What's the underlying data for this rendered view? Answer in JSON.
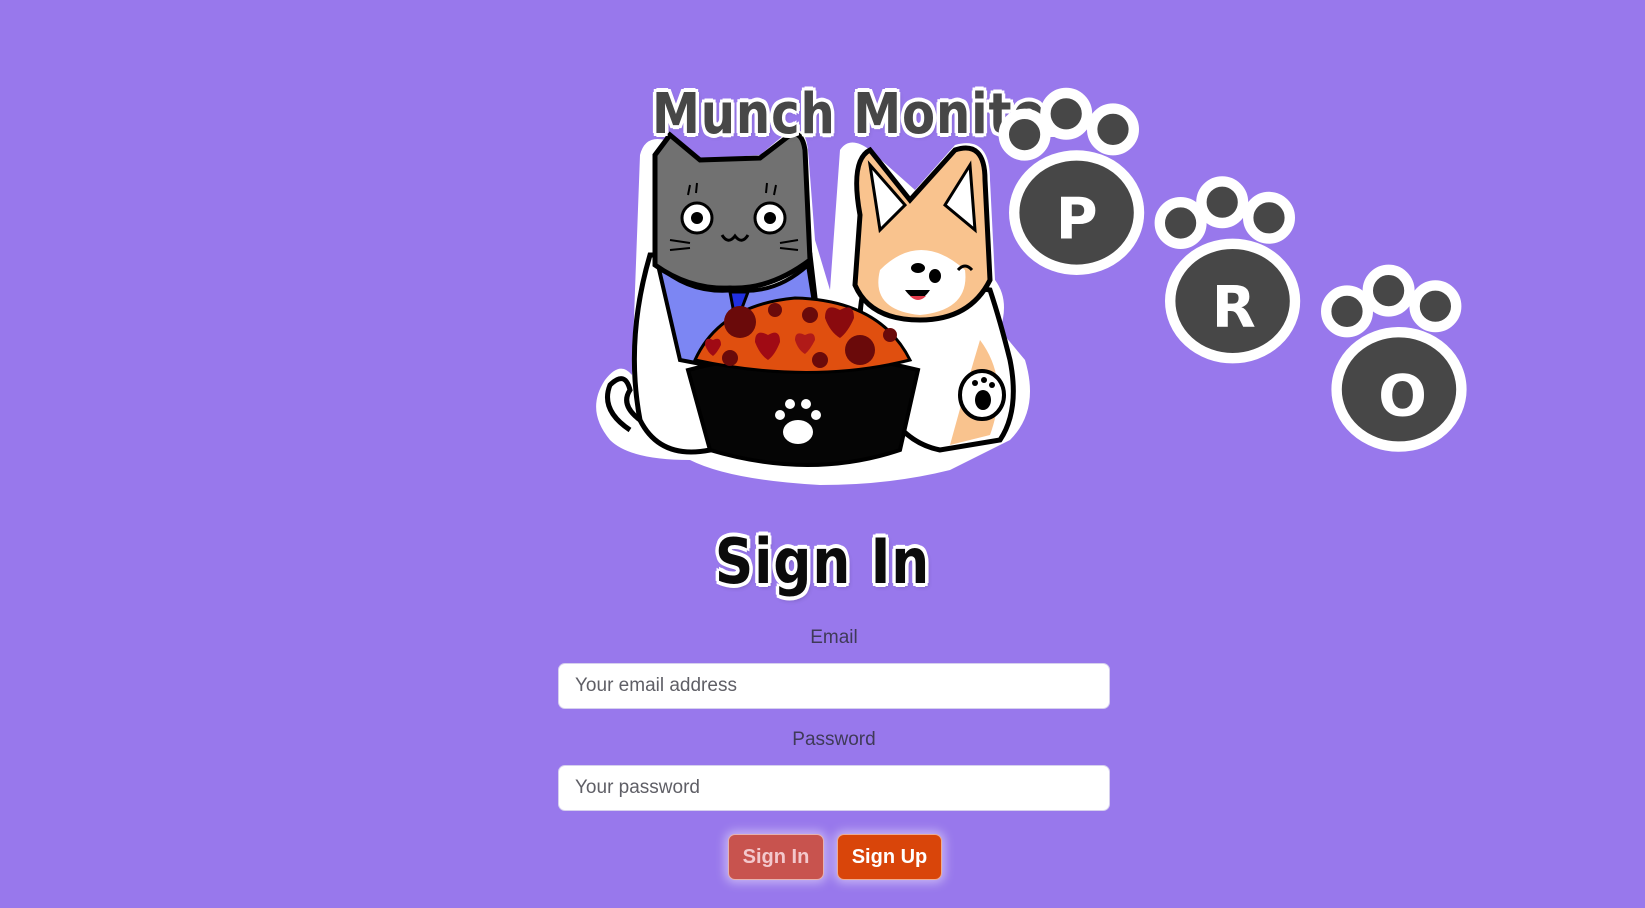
{
  "logo": {
    "title": "Munch Monitor",
    "badge": "PRO"
  },
  "form": {
    "heading": "Sign In",
    "email_label": "Email",
    "email_placeholder": "Your email address",
    "email_value": "",
    "password_label": "Password",
    "password_placeholder": "Your password",
    "password_value": ""
  },
  "buttons": {
    "signin_label": "Sign In",
    "signup_label": "Sign Up"
  },
  "colors": {
    "background": "#9878ec",
    "signin_button": "#c8534e",
    "signup_button": "#d9450a"
  },
  "icons": {
    "logo": "munch-monitor-logo",
    "paw": "paw-icon"
  }
}
